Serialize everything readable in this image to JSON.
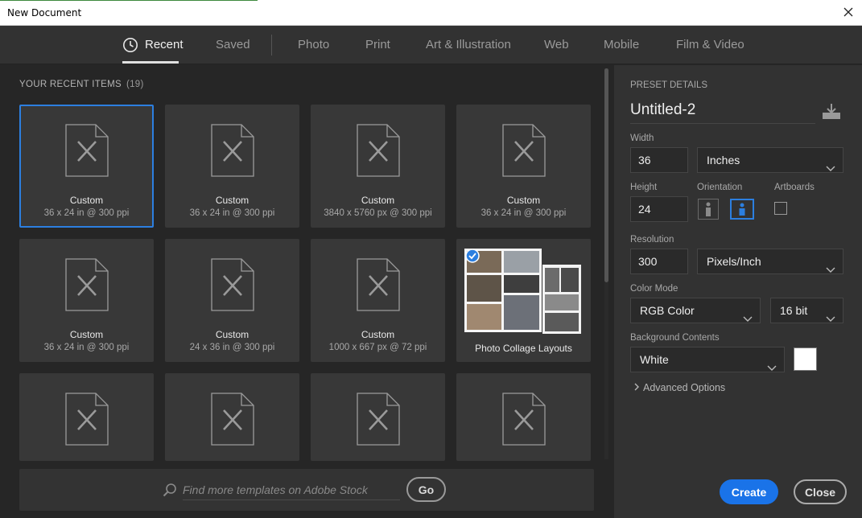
{
  "window": {
    "title": "New Document"
  },
  "tabs": [
    {
      "label": "Recent",
      "active": true
    },
    {
      "label": "Saved"
    },
    {
      "label": "Photo"
    },
    {
      "label": "Print"
    },
    {
      "label": "Art & Illustration"
    },
    {
      "label": "Web"
    },
    {
      "label": "Mobile"
    },
    {
      "label": "Film & Video"
    }
  ],
  "recent": {
    "heading": "YOUR RECENT ITEMS",
    "count": "(19)",
    "items": [
      {
        "name": "Custom",
        "dims": "36 x 24 in @ 300 ppi"
      },
      {
        "name": "Custom",
        "dims": "36 x 24 in @ 300 ppi"
      },
      {
        "name": "Custom",
        "dims": "3840 x 5760 px @ 300 ppi"
      },
      {
        "name": "Custom",
        "dims": "36 x 24 in @ 300 ppi"
      },
      {
        "name": "Custom",
        "dims": "36 x 24 in @ 300 ppi"
      },
      {
        "name": "Custom",
        "dims": "24 x 36 in @ 300 ppi"
      },
      {
        "name": "Custom",
        "dims": "1000 x 667 px @ 72 ppi"
      },
      {
        "name": "Photo Collage Layouts"
      }
    ]
  },
  "stock": {
    "placeholder": "Find more templates on Adobe Stock",
    "go_label": "Go"
  },
  "preset": {
    "heading": "PRESET DETAILS",
    "doc_name": "Untitled-2",
    "width_label": "Width",
    "width_value": "36",
    "width_unit": "Inches",
    "height_label": "Height",
    "height_value": "24",
    "orientation_label": "Orientation",
    "artboards_label": "Artboards",
    "resolution_label": "Resolution",
    "resolution_value": "300",
    "resolution_unit": "Pixels/Inch",
    "color_mode_label": "Color Mode",
    "color_mode": "RGB Color",
    "bit_depth": "16 bit",
    "background_label": "Background Contents",
    "background_value": "White",
    "advanced_label": "Advanced Options"
  },
  "actions": {
    "create": "Create",
    "close": "Close"
  },
  "colors": {
    "accent": "#1a73e8",
    "selection": "#2c7fe0",
    "panel": "#323232"
  }
}
